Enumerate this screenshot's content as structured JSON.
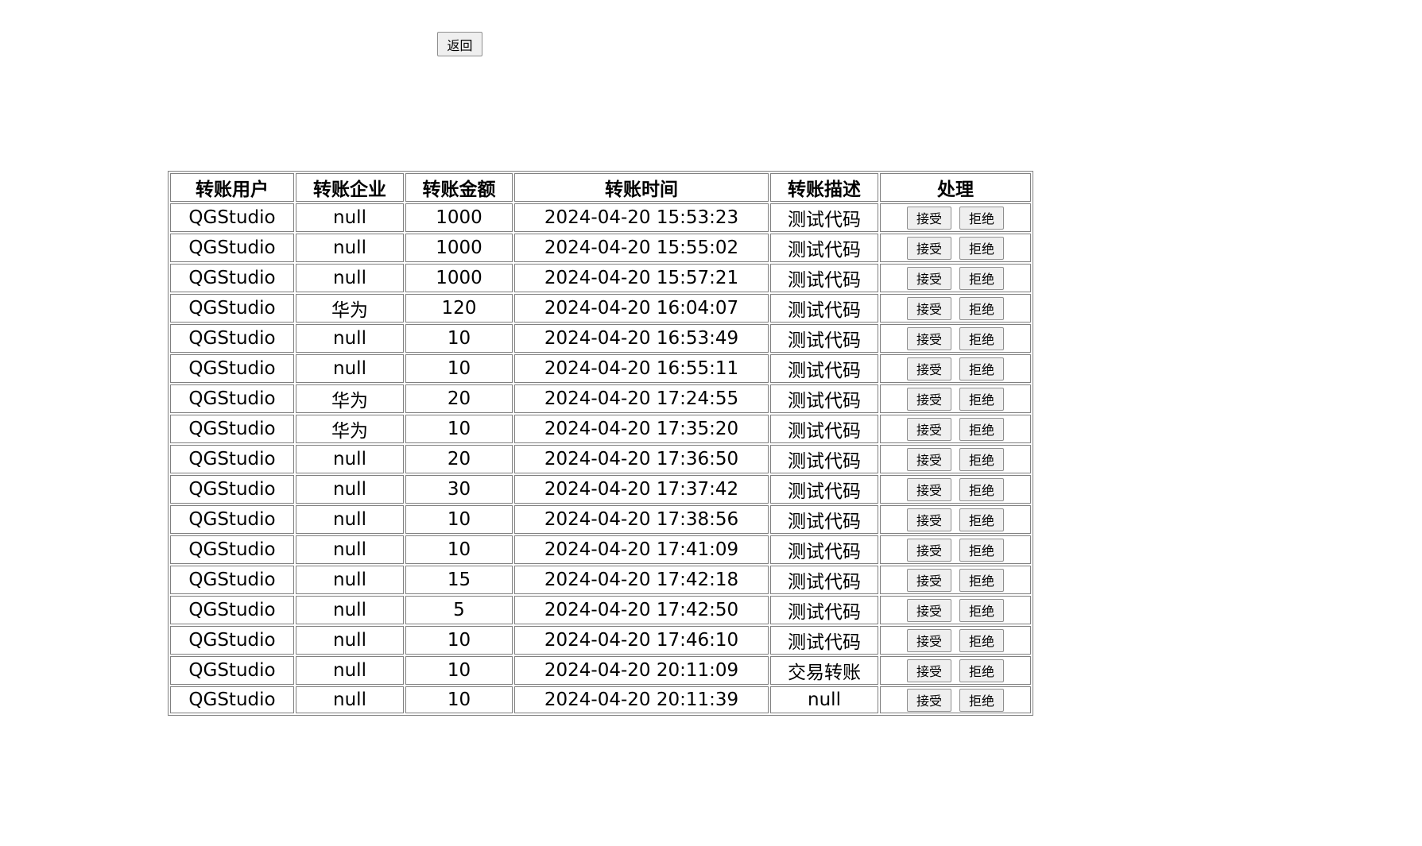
{
  "back_button_label": "返回",
  "table": {
    "headers": [
      "转账用户",
      "转账企业",
      "转账金额",
      "转账时间",
      "转账描述",
      "处理"
    ],
    "accept_label": "接受",
    "reject_label": "拒绝",
    "rows": [
      {
        "user": "QGStudio",
        "company": "null",
        "amount": "1000",
        "time": "2024-04-20 15:53:23",
        "description": "测试代码"
      },
      {
        "user": "QGStudio",
        "company": "null",
        "amount": "1000",
        "time": "2024-04-20 15:55:02",
        "description": "测试代码"
      },
      {
        "user": "QGStudio",
        "company": "null",
        "amount": "1000",
        "time": "2024-04-20 15:57:21",
        "description": "测试代码"
      },
      {
        "user": "QGStudio",
        "company": "华为",
        "amount": "120",
        "time": "2024-04-20 16:04:07",
        "description": "测试代码"
      },
      {
        "user": "QGStudio",
        "company": "null",
        "amount": "10",
        "time": "2024-04-20 16:53:49",
        "description": "测试代码"
      },
      {
        "user": "QGStudio",
        "company": "null",
        "amount": "10",
        "time": "2024-04-20 16:55:11",
        "description": "测试代码"
      },
      {
        "user": "QGStudio",
        "company": "华为",
        "amount": "20",
        "time": "2024-04-20 17:24:55",
        "description": "测试代码"
      },
      {
        "user": "QGStudio",
        "company": "华为",
        "amount": "10",
        "time": "2024-04-20 17:35:20",
        "description": "测试代码"
      },
      {
        "user": "QGStudio",
        "company": "null",
        "amount": "20",
        "time": "2024-04-20 17:36:50",
        "description": "测试代码"
      },
      {
        "user": "QGStudio",
        "company": "null",
        "amount": "30",
        "time": "2024-04-20 17:37:42",
        "description": "测试代码"
      },
      {
        "user": "QGStudio",
        "company": "null",
        "amount": "10",
        "time": "2024-04-20 17:38:56",
        "description": "测试代码"
      },
      {
        "user": "QGStudio",
        "company": "null",
        "amount": "10",
        "time": "2024-04-20 17:41:09",
        "description": "测试代码"
      },
      {
        "user": "QGStudio",
        "company": "null",
        "amount": "15",
        "time": "2024-04-20 17:42:18",
        "description": "测试代码"
      },
      {
        "user": "QGStudio",
        "company": "null",
        "amount": "5",
        "time": "2024-04-20 17:42:50",
        "description": "测试代码"
      },
      {
        "user": "QGStudio",
        "company": "null",
        "amount": "10",
        "time": "2024-04-20 17:46:10",
        "description": "测试代码"
      },
      {
        "user": "QGStudio",
        "company": "null",
        "amount": "10",
        "time": "2024-04-20 20:11:09",
        "description": "交易转账"
      },
      {
        "user": "QGStudio",
        "company": "null",
        "amount": "10",
        "time": "2024-04-20 20:11:39",
        "description": "null"
      }
    ]
  }
}
